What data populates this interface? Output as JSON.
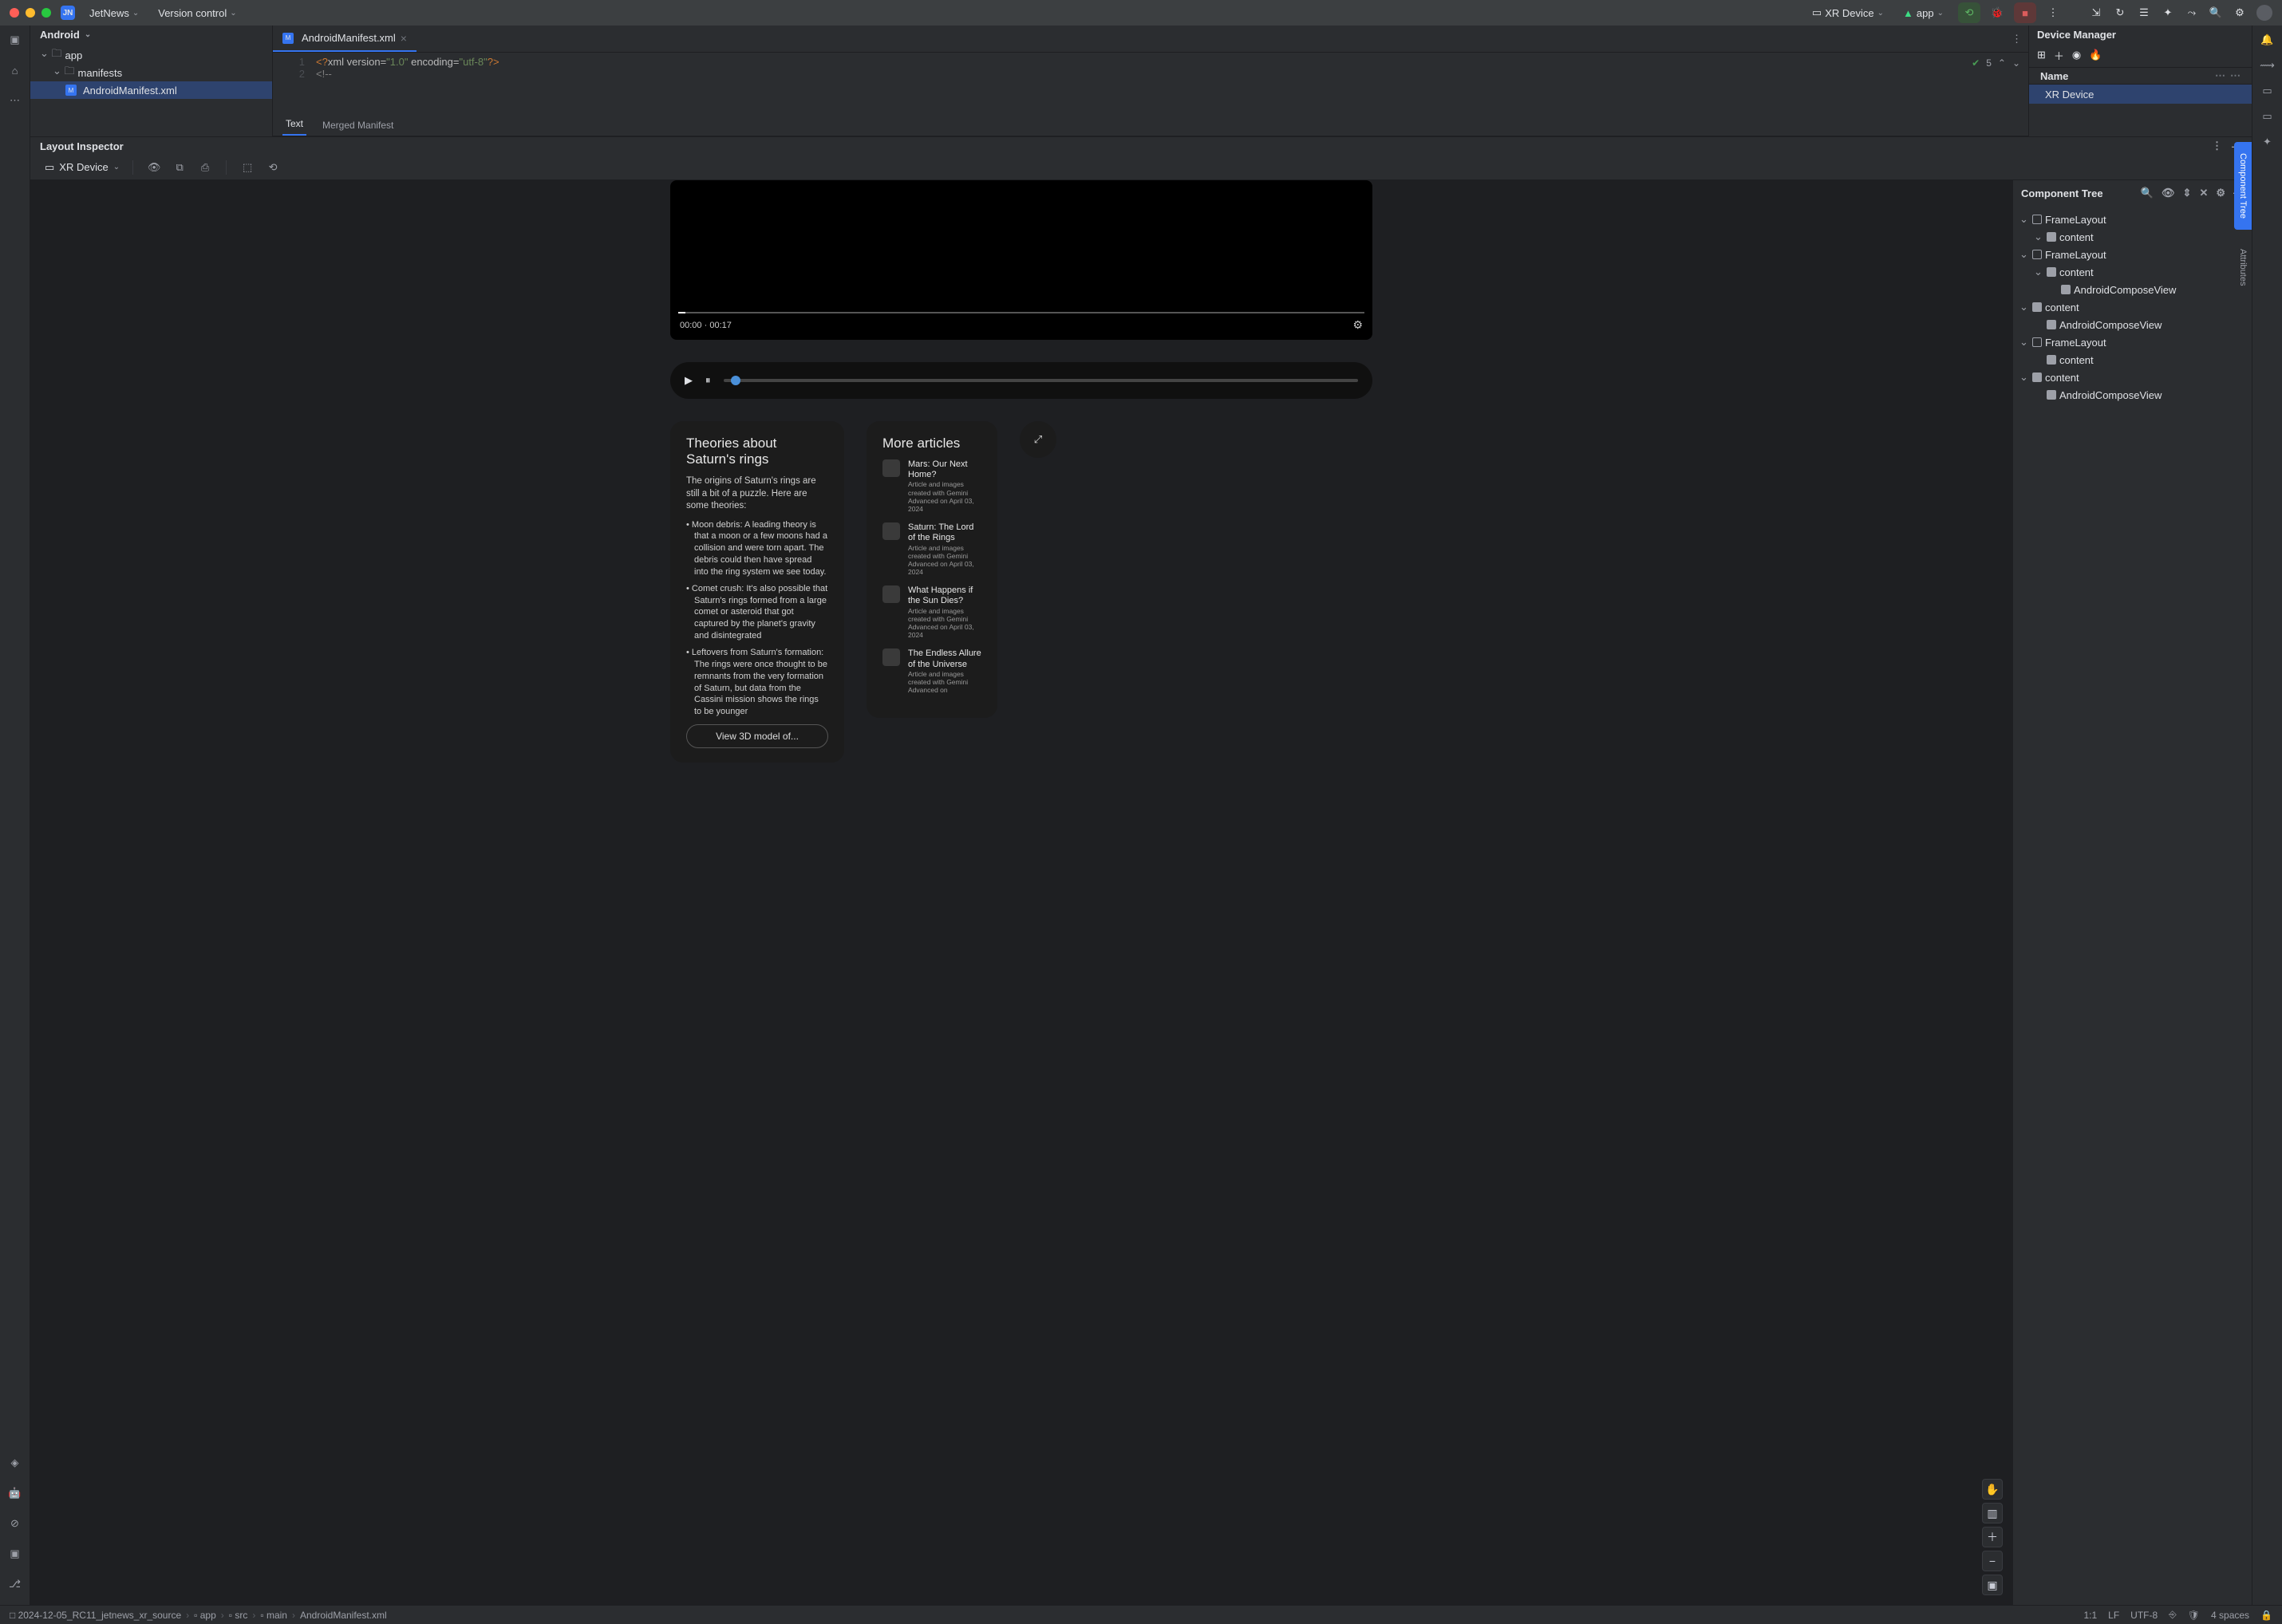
{
  "titlebar": {
    "project_name": "JetNews",
    "vcs_label": "Version control",
    "device_label": "XR Device",
    "run_config": "app"
  },
  "project_panel": {
    "header": "Android",
    "items": [
      {
        "label": "app",
        "indent": 0,
        "expanded": true,
        "kind": "module"
      },
      {
        "label": "manifests",
        "indent": 1,
        "expanded": true,
        "kind": "folder"
      },
      {
        "label": "AndroidManifest.xml",
        "indent": 2,
        "kind": "file",
        "selected": true
      }
    ]
  },
  "editor": {
    "tab_label": "AndroidManifest.xml",
    "lines": [
      "<?xml version=\"1.0\" encoding=\"utf-8\"?>",
      "<!--"
    ],
    "warnings": "5",
    "sub_tabs": {
      "text": "Text",
      "merged": "Merged Manifest"
    }
  },
  "device_manager": {
    "title": "Device Manager",
    "col_name": "Name",
    "row": "XR Device"
  },
  "layout_inspector": {
    "title": "Layout Inspector",
    "device": "XR Device"
  },
  "component_tree": {
    "title": "Component Tree",
    "nodes": [
      {
        "label": "FrameLayout",
        "indent": 0,
        "expanded": true,
        "icon": "sq"
      },
      {
        "label": "content",
        "indent": 1,
        "expanded": true,
        "icon": "sqf"
      },
      {
        "label": "FrameLayout",
        "indent": 0,
        "expanded": true,
        "icon": "sq"
      },
      {
        "label": "content",
        "indent": 1,
        "expanded": true,
        "icon": "sqf"
      },
      {
        "label": "AndroidComposeView",
        "indent": 2,
        "icon": "sqf"
      },
      {
        "label": "content",
        "indent": 0,
        "expanded": true,
        "icon": "sqf"
      },
      {
        "label": "AndroidComposeView",
        "indent": 1,
        "icon": "sqf"
      },
      {
        "label": "FrameLayout",
        "indent": 0,
        "expanded": true,
        "icon": "sq"
      },
      {
        "label": "content",
        "indent": 1,
        "icon": "sqf"
      },
      {
        "label": "content",
        "indent": 0,
        "expanded": true,
        "icon": "sqf"
      },
      {
        "label": "AndroidComposeView",
        "indent": 1,
        "icon": "sqf"
      }
    ]
  },
  "side_tabs": {
    "component_tree": "Component Tree",
    "attributes": "Attributes"
  },
  "preview": {
    "video": {
      "time_current": "00:00",
      "time_dot": "·",
      "time_total": "00:17"
    },
    "theories": {
      "title": "Theories about Saturn's rings",
      "intro": "The origins of Saturn's rings are still a bit of a puzzle. Here are some theories:",
      "bullets": [
        "Moon debris: A leading theory is that a moon or a few moons had a collision and were torn apart. The debris could then have spread into the ring system we see today.",
        "Comet crush: It's also possible that Saturn's rings formed from a large comet or asteroid that got captured by the planet's gravity and disintegrated",
        "Leftovers from Saturn's formation: The rings were once thought to be remnants from the very formation of Saturn, but data from the Cassini mission shows the rings to be younger"
      ],
      "button": "View 3D model of..."
    },
    "more": {
      "title": "More articles",
      "items": [
        {
          "title": "Mars: Our Next Home?",
          "sub": "Article and images created with Gemini Advanced on April 03, 2024"
        },
        {
          "title": "Saturn: The Lord of the Rings",
          "sub": "Article and images created with Gemini Advanced on April 03, 2024"
        },
        {
          "title": "What Happens if the Sun Dies?",
          "sub": "Article and images created with Gemini Advanced on April 03, 2024"
        },
        {
          "title": "The Endless Allure of the Universe",
          "sub": "Article and images created with Gemini Advanced on"
        }
      ]
    }
  },
  "status": {
    "breadcrumb": [
      "2024-12-05_RC11_jetnews_xr_source",
      "app",
      "src",
      "main",
      "AndroidManifest.xml"
    ],
    "pos": "1:1",
    "le": "LF",
    "enc": "UTF-8",
    "indent": "4 spaces"
  }
}
